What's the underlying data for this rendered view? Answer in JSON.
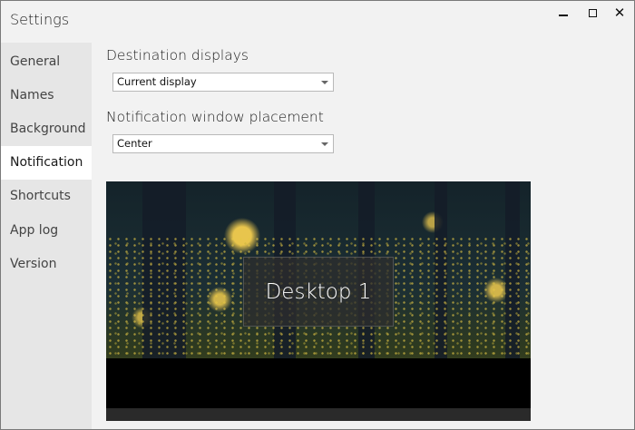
{
  "window": {
    "title": "Settings",
    "minimize_icon": "minimize-icon",
    "maximize_icon": "maximize-icon",
    "close_icon": "close-icon"
  },
  "sidebar": {
    "items": [
      {
        "label": "General"
      },
      {
        "label": "Names"
      },
      {
        "label": "Background"
      },
      {
        "label": "Notification",
        "active": true
      },
      {
        "label": "Shortcuts"
      },
      {
        "label": "App log"
      },
      {
        "label": "Version"
      }
    ]
  },
  "notification": {
    "destination_label": "Destination displays",
    "destination_value": "Current display",
    "placement_label": "Notification window placement",
    "placement_value": "Center",
    "preview_text": "Desktop 1"
  }
}
